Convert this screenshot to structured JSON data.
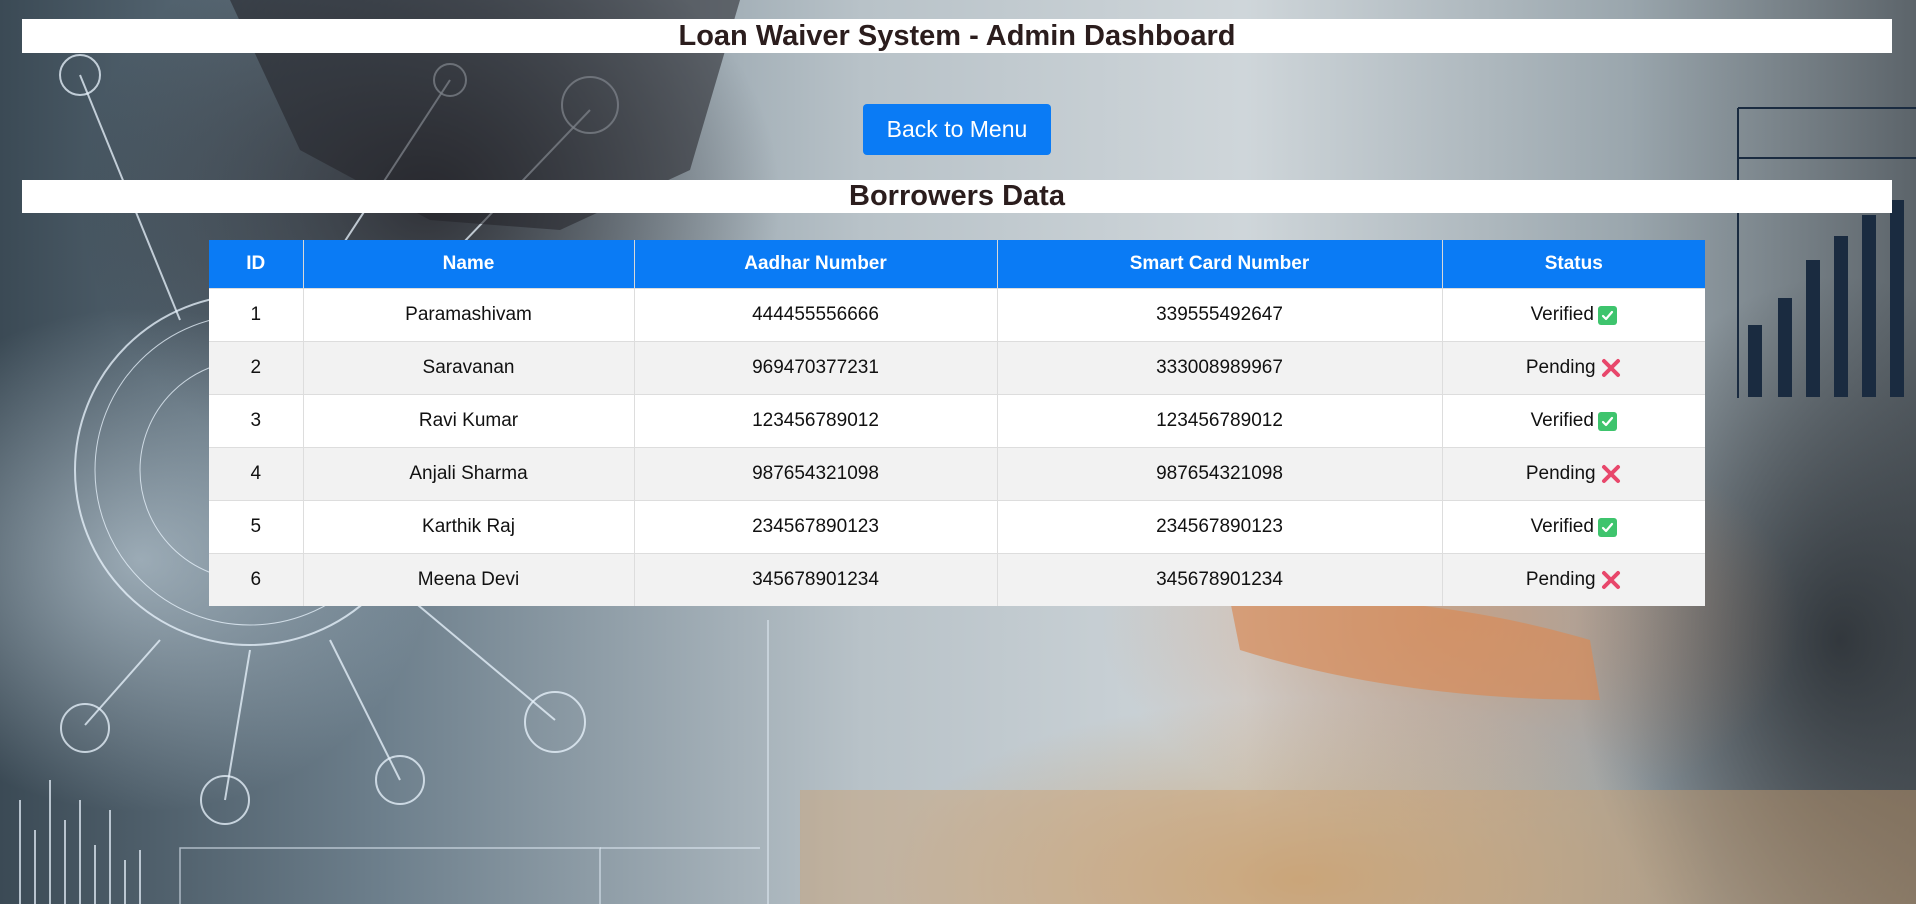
{
  "header": {
    "title": "Loan Waiver System - Admin Dashboard"
  },
  "actions": {
    "back_label": "Back to Menu"
  },
  "section": {
    "title": "Borrowers Data"
  },
  "table": {
    "columns": [
      "ID",
      "Name",
      "Aadhar Number",
      "Smart Card Number",
      "Status"
    ],
    "rows": [
      {
        "id": "1",
        "name": "Paramashivam",
        "aadhar": "444455556666",
        "smart_card": "339555492647",
        "status": "Verified",
        "status_icon": "check-mark-icon"
      },
      {
        "id": "2",
        "name": "Saravanan",
        "aadhar": "969470377231",
        "smart_card": "333008989967",
        "status": "Pending",
        "status_icon": "cross-mark-icon"
      },
      {
        "id": "3",
        "name": "Ravi Kumar",
        "aadhar": "123456789012",
        "smart_card": "123456789012",
        "status": "Verified",
        "status_icon": "check-mark-icon"
      },
      {
        "id": "4",
        "name": "Anjali Sharma",
        "aadhar": "987654321098",
        "smart_card": "987654321098",
        "status": "Pending",
        "status_icon": "cross-mark-icon"
      },
      {
        "id": "5",
        "name": "Karthik Raj",
        "aadhar": "234567890123",
        "smart_card": "234567890123",
        "status": "Verified",
        "status_icon": "check-mark-icon"
      },
      {
        "id": "6",
        "name": "Meena Devi",
        "aadhar": "345678901234",
        "smart_card": "345678901234",
        "status": "Pending",
        "status_icon": "cross-mark-icon"
      }
    ]
  },
  "colors": {
    "accent": "#0a7bf5",
    "heading_text": "#2b1d1d",
    "verified": "#3ec46d",
    "pending": "#e8476b"
  }
}
